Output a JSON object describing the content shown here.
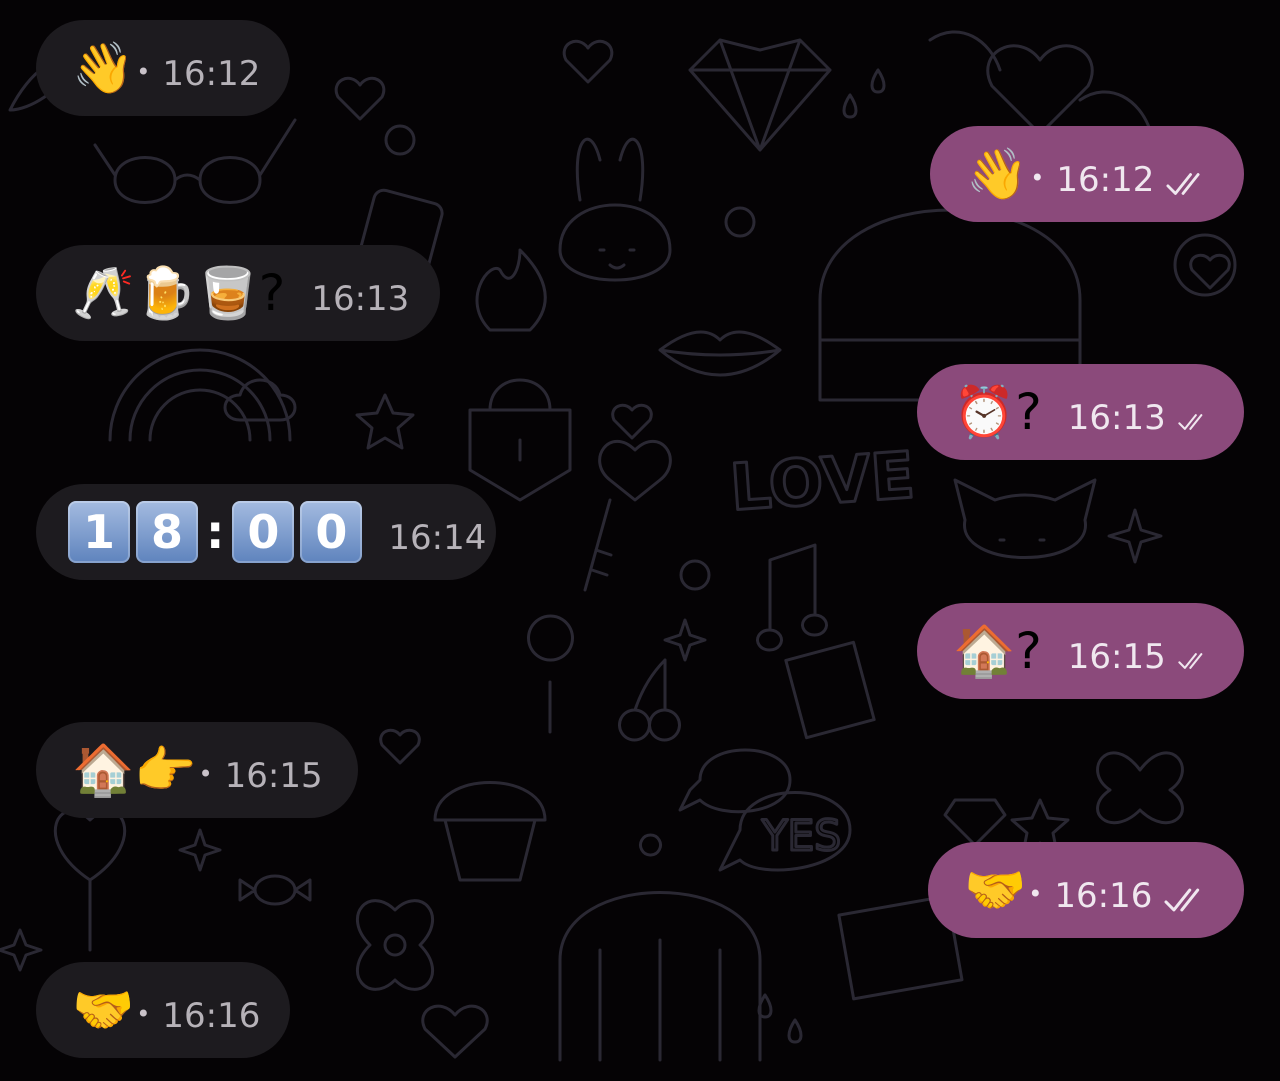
{
  "chat": {
    "incoming": [
      {
        "content": "👋",
        "time": "16:12",
        "dot": true
      },
      {
        "content": "🥂🍺🥃?",
        "time": "16:13",
        "dot": false
      },
      {
        "content_keycaps": [
          "1",
          "8",
          ":",
          "0",
          "0"
        ],
        "time": "16:14"
      },
      {
        "content": "🏠👉",
        "time": "16:15",
        "dot": true
      },
      {
        "content": "🤝",
        "time": "16:16",
        "dot": true
      }
    ],
    "outgoing": [
      {
        "content": "👋",
        "time": "16:12",
        "dot": true,
        "status": "read"
      },
      {
        "content": "⏰?",
        "time": "16:13",
        "dot": false,
        "status": "read"
      },
      {
        "content": "🏠?",
        "time": "16:15",
        "dot": false,
        "status": "read"
      },
      {
        "content": "🤝",
        "time": "16:16",
        "dot": true,
        "status": "read"
      }
    ],
    "icons": {
      "read_receipt": "double-check-icon",
      "dot": "bullet"
    },
    "background_doodle_text": [
      "LOVE",
      "YES"
    ]
  },
  "colors": {
    "background": "#050305",
    "incoming_bubble": "#1d1b1f",
    "outgoing_bubble": "#8b4a7b",
    "doodle_stroke": "#2a2833"
  }
}
